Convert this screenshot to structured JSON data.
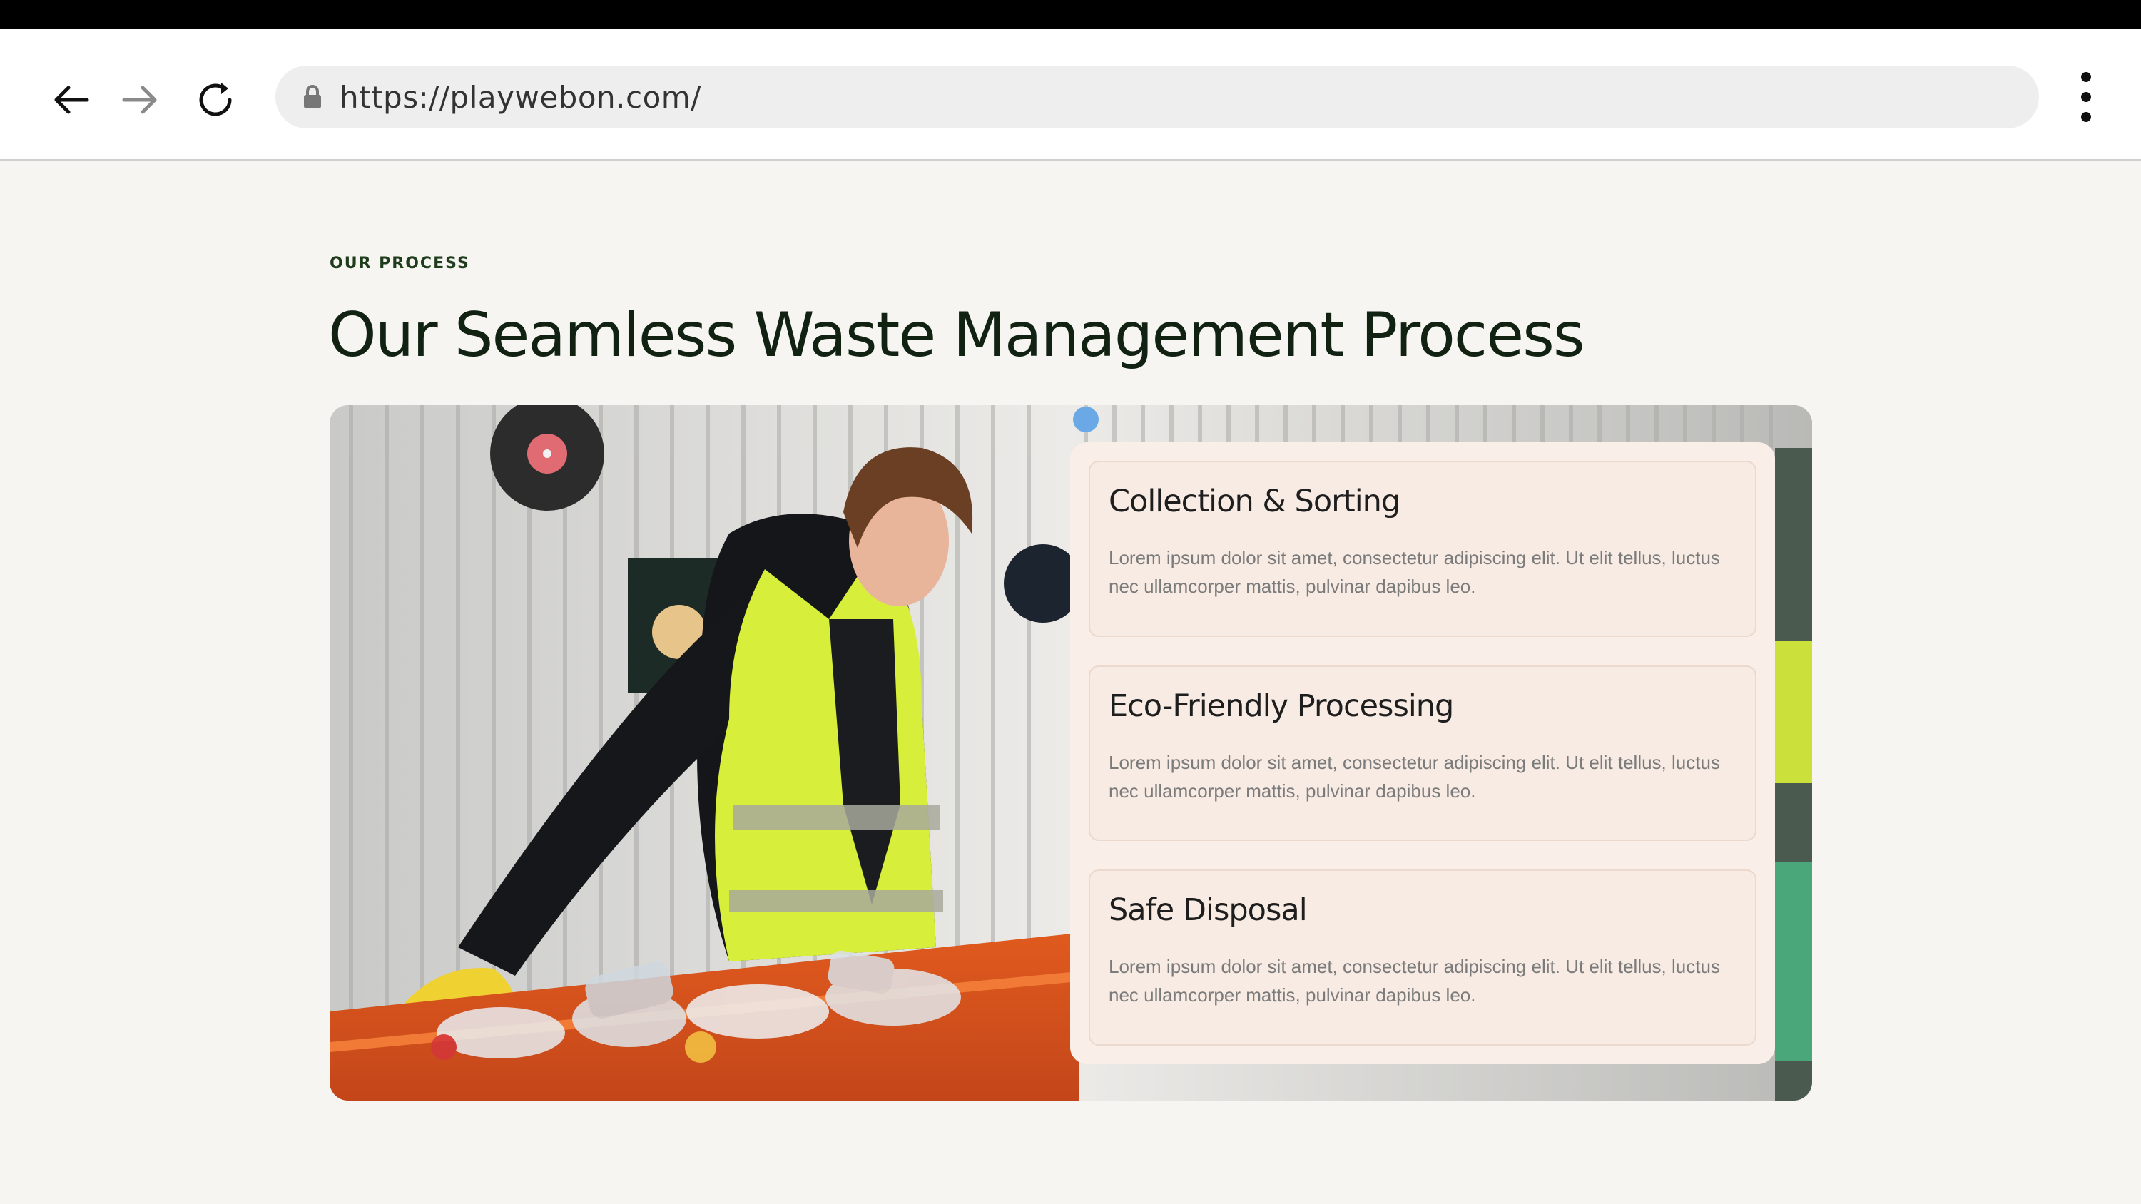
{
  "browser": {
    "url": "https://playwebon.com/",
    "icons": [
      "back-arrow-icon",
      "forward-arrow-icon",
      "reload-icon",
      "lock-icon",
      "more-vert-icon"
    ]
  },
  "section": {
    "eyebrow": "OUR PROCESS",
    "title": "Our Seamless Waste Management Process"
  },
  "hero": {
    "image": "worker-sorting-recyclables-photo"
  },
  "steps": [
    {
      "title": "Collection & Sorting",
      "description": "Lorem ipsum dolor sit amet, consectetur adipiscing elit. Ut elit tellus, luctus nec ullamcorper mattis, pulvinar dapibus leo."
    },
    {
      "title": "Eco-Friendly Processing",
      "description": "Lorem ipsum dolor sit amet, consectetur adipiscing elit. Ut elit tellus, luctus nec ullamcorper mattis, pulvinar dapibus leo."
    },
    {
      "title": "Safe Disposal",
      "description": "Lorem ipsum dolor sit amet, consectetur adipiscing elit. Ut elit tellus, luctus nec ullamcorper mattis, pulvinar dapibus leo."
    }
  ],
  "colors": {
    "page_bg": "#f7f5f1",
    "heading": "#122212",
    "eyebrow": "#1f3d1c",
    "card_bg": "#f7ebe3",
    "vest": "#d7ee3a"
  }
}
